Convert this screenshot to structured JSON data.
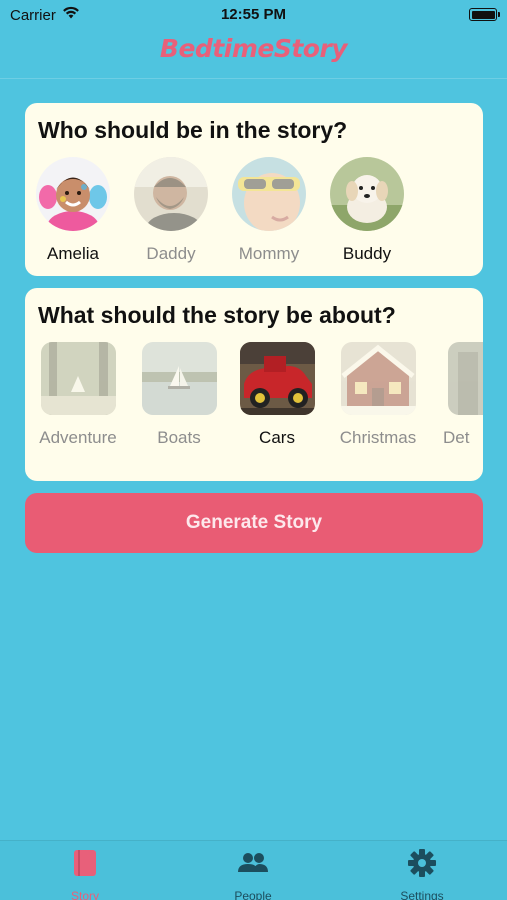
{
  "status_bar": {
    "carrier": "Carrier",
    "time": "12:55 PM"
  },
  "app": {
    "title": "BedtimeStory",
    "accent": "#e8607a",
    "background": "#4fc4df"
  },
  "people_card": {
    "heading": "Who should be in the story?",
    "people": [
      {
        "name": "Amelia",
        "selected": true
      },
      {
        "name": "Daddy",
        "selected": false
      },
      {
        "name": "Mommy",
        "selected": false
      },
      {
        "name": "Buddy",
        "selected": true
      }
    ]
  },
  "topics_card": {
    "heading": "What should the story be about?",
    "topics": [
      {
        "name": "Adventure",
        "selected": false
      },
      {
        "name": "Boats",
        "selected": false
      },
      {
        "name": "Cars",
        "selected": true
      },
      {
        "name": "Christmas",
        "selected": false
      },
      {
        "name": "Det",
        "selected": false
      }
    ]
  },
  "generate_button": {
    "label": "Generate Story",
    "color": "#e95c74"
  },
  "tab_bar": {
    "tabs": [
      {
        "label": "Story",
        "icon": "book-icon",
        "active": true
      },
      {
        "label": "People",
        "icon": "people-icon",
        "active": false
      },
      {
        "label": "Settings",
        "icon": "gear-icon",
        "active": false
      }
    ]
  }
}
